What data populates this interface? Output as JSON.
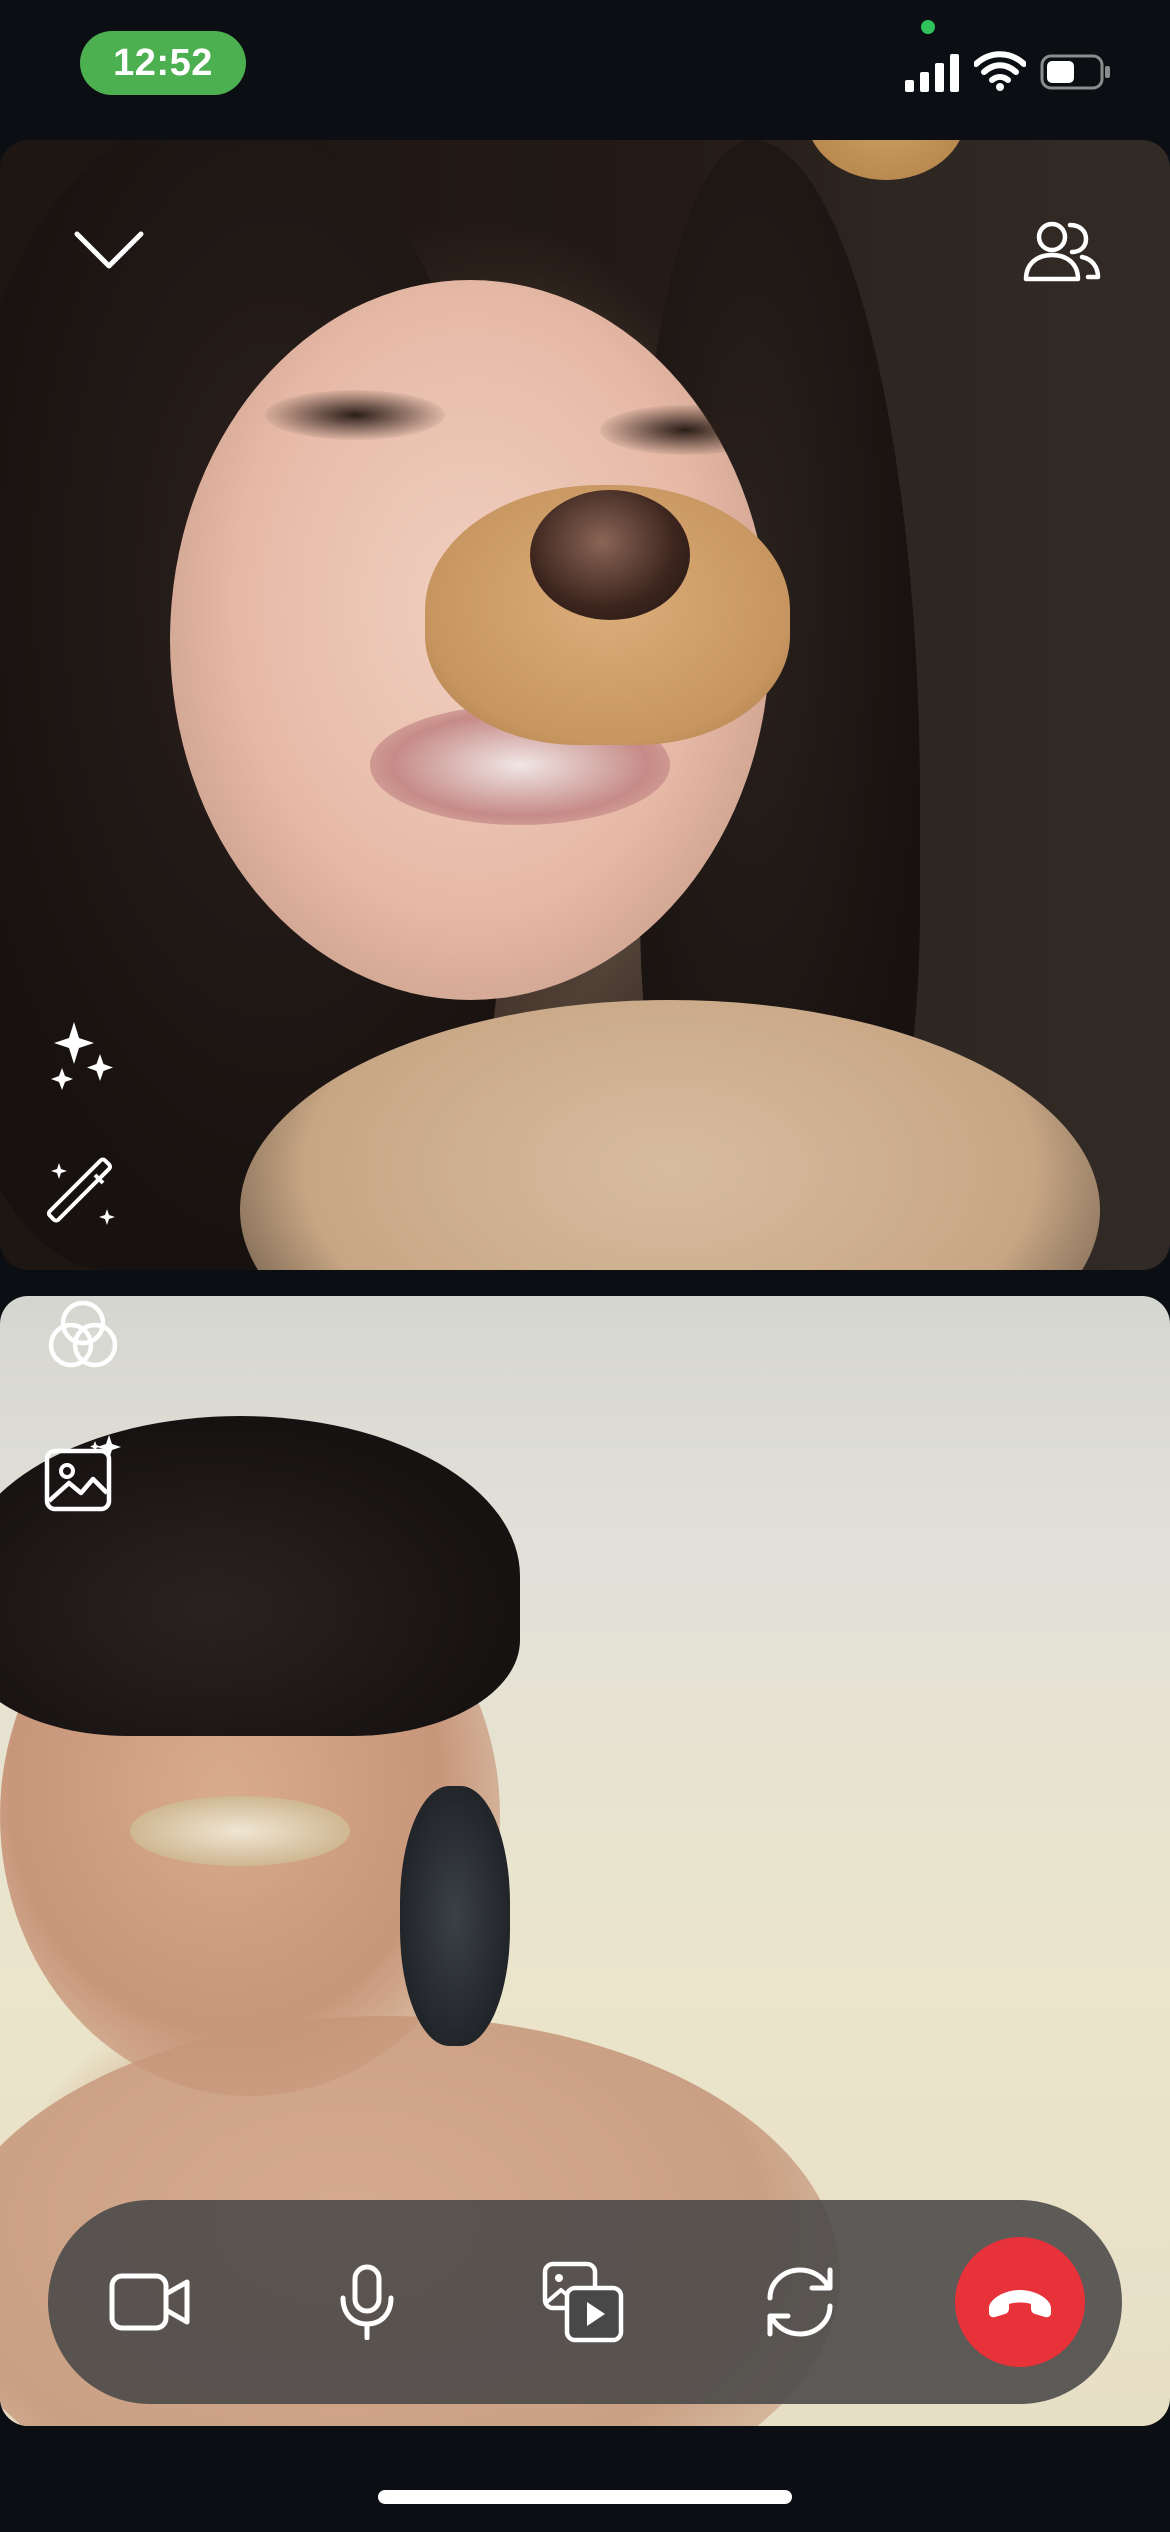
{
  "status_bar": {
    "time": "12:52",
    "time_pill_color": "#4caf50",
    "camera_indicator_color": "#2fc15a",
    "signal_icon": "cellular-signal-icon",
    "wifi_icon": "wifi-icon",
    "battery_icon": "battery-icon",
    "battery_level_fraction": 0.45
  },
  "remote_video": {
    "description_icons": {
      "collapse": "chevron-down-icon",
      "participants": "people-icon",
      "effects": "sparkles-icon",
      "retouch": "magic-wand-icon",
      "filters": "color-circles-icon",
      "background": "image-sparkle-icon"
    }
  },
  "call_controls": {
    "video": "video-camera-icon",
    "mic": "microphone-icon",
    "share": "share-media-icon",
    "flip": "flip-camera-icon",
    "end": "end-call-icon",
    "end_call_color": "#e8323a",
    "bar_color": "#484848"
  }
}
